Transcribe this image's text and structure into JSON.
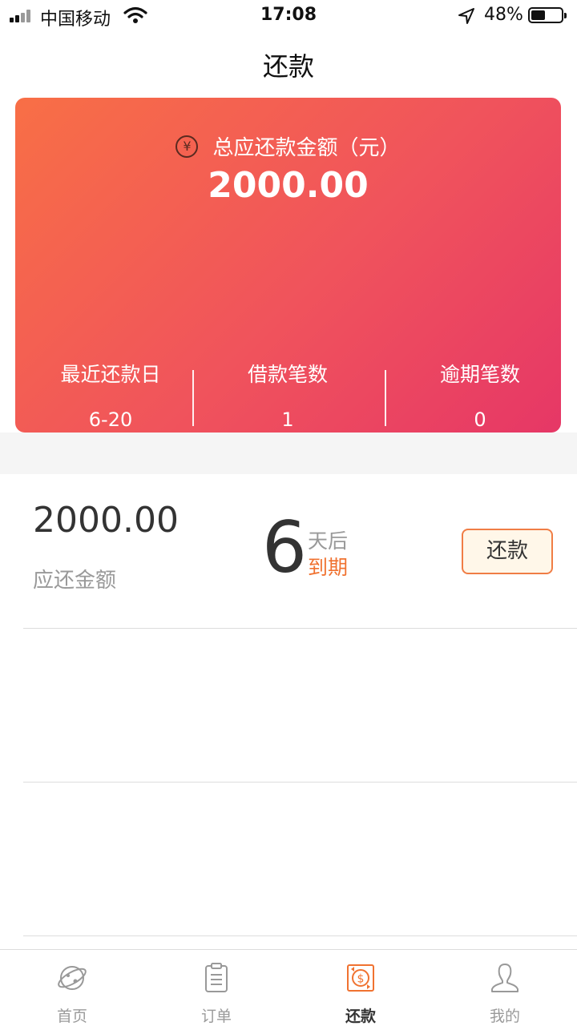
{
  "status": {
    "carrier": "中国移动",
    "time": "17:08",
    "battery": "48%",
    "battery_level": 0.48
  },
  "nav": {
    "title": "还款"
  },
  "summary": {
    "total_label": "总应还款金额（元）",
    "total_amount": "2000.00",
    "stats": [
      {
        "label": "最近还款日",
        "value": "6-20"
      },
      {
        "label": "借款笔数",
        "value": "1"
      },
      {
        "label": "逾期笔数",
        "value": "0"
      }
    ]
  },
  "bill": {
    "amount": "2000.00",
    "amount_label": "应还金额",
    "due_days": "6",
    "due_unit": "天后",
    "due_word": "到期",
    "repay_button": "还款"
  },
  "tabs": [
    {
      "label": "首页",
      "icon": "planet-icon",
      "active": false
    },
    {
      "label": "订单",
      "icon": "clipboard-icon",
      "active": false
    },
    {
      "label": "还款",
      "icon": "dollar-repay-icon",
      "active": true
    },
    {
      "label": "我的",
      "icon": "person-icon",
      "active": false
    }
  ],
  "colors": {
    "card_gradient_start": "#f86f46",
    "card_gradient_end": "#e63766",
    "accent": "#f07230"
  }
}
